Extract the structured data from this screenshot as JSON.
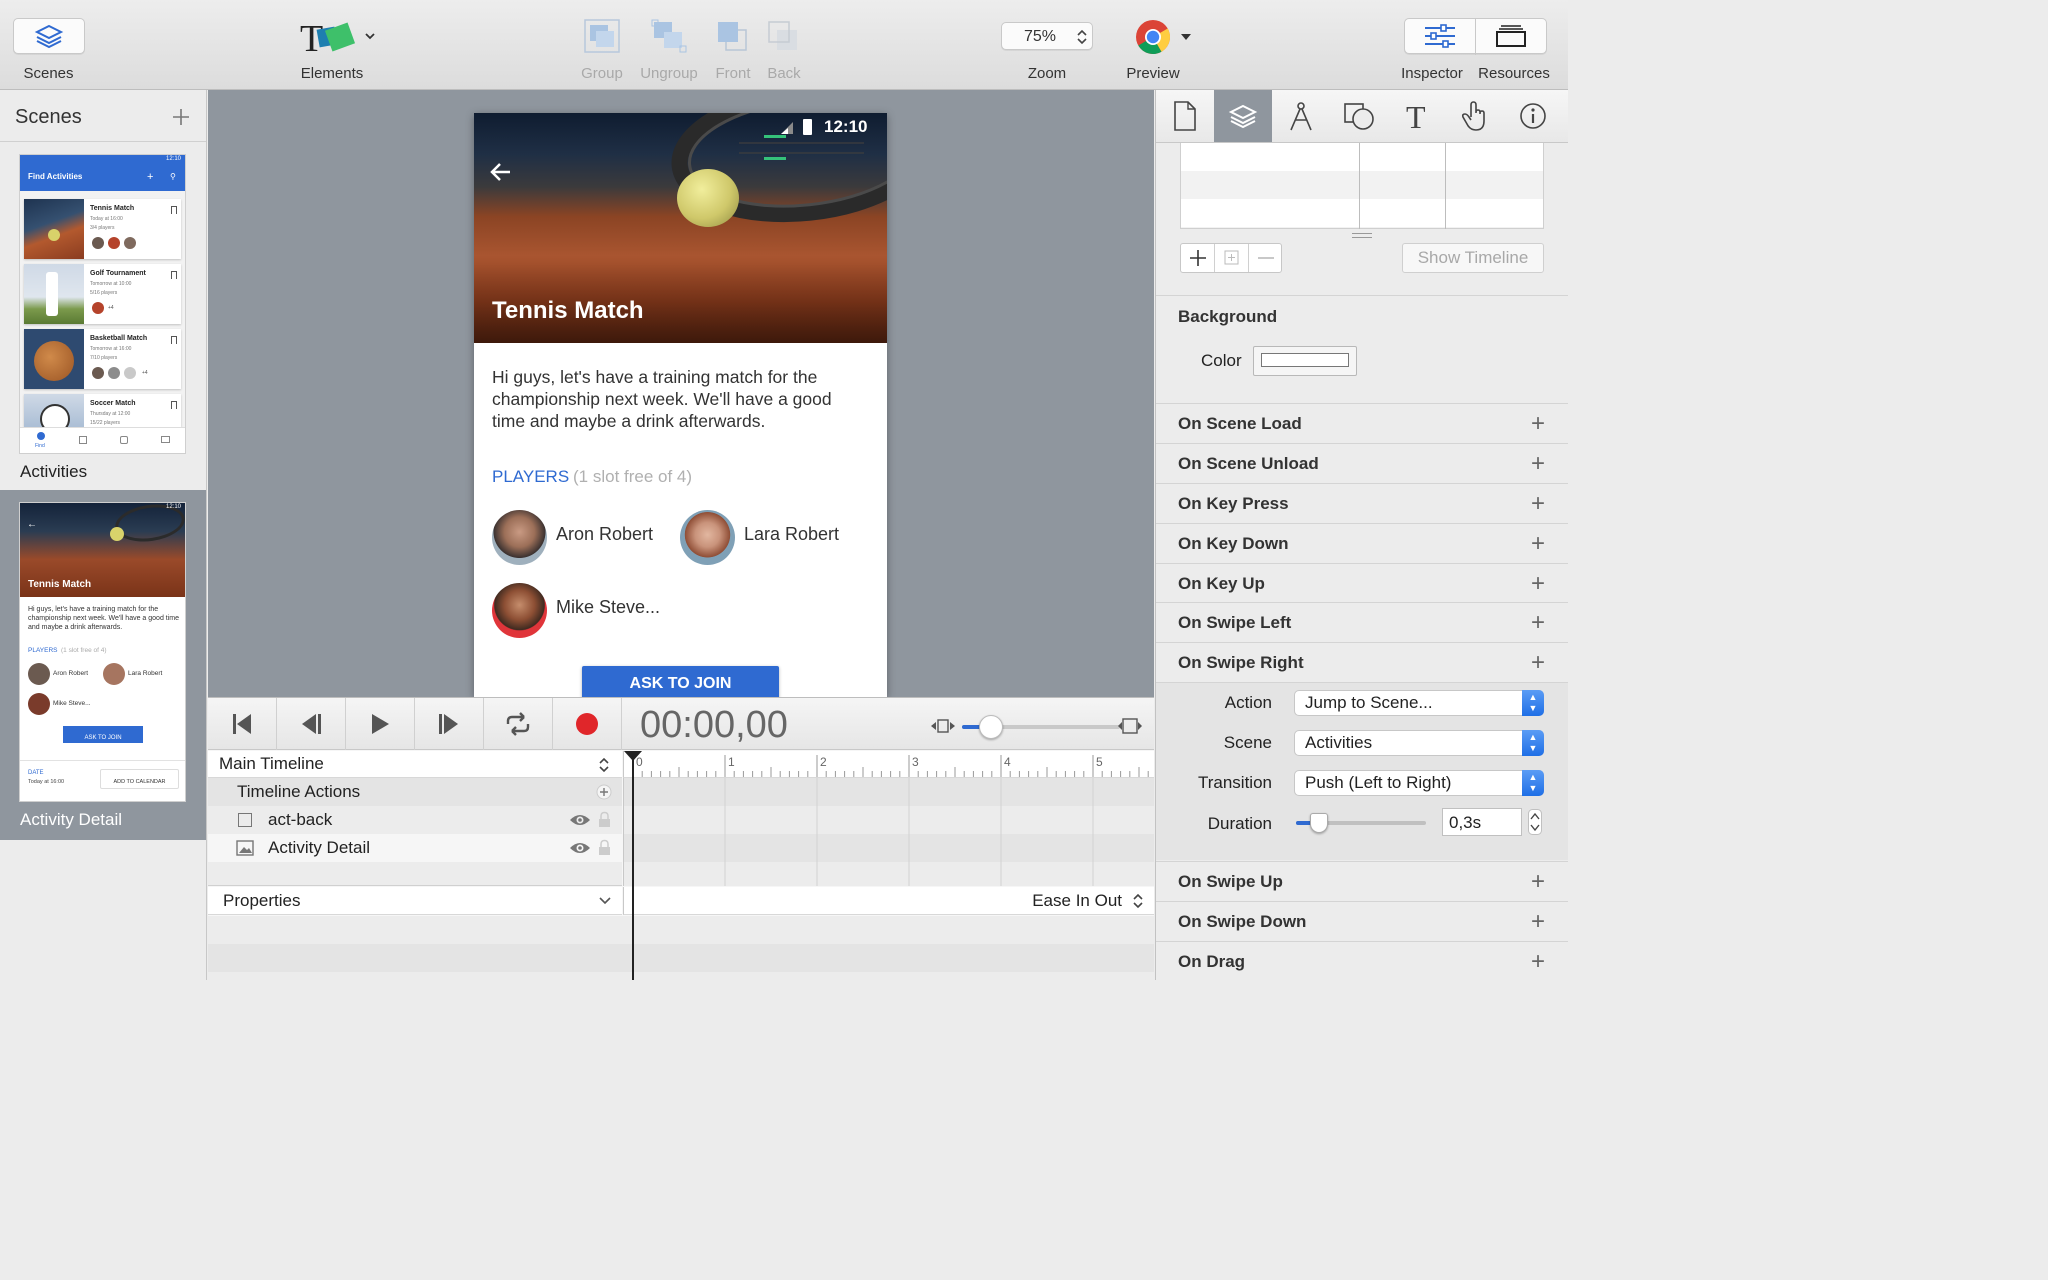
{
  "toolbar": {
    "scenes": "Scenes",
    "elements": "Elements",
    "group": "Group",
    "ungroup": "Ungroup",
    "front": "Front",
    "back": "Back",
    "zoom_value": "75%",
    "zoom": "Zoom",
    "preview": "Preview",
    "inspector": "Inspector",
    "resources": "Resources"
  },
  "scenes_panel": {
    "title": "Scenes",
    "scene1": {
      "name": "Activities",
      "time": "12:10",
      "header": "Find Activities",
      "cards": [
        {
          "title": "Tennis Match",
          "line1": "Today at 16:00",
          "line2": "3/4 players"
        },
        {
          "title": "Golf Tournament",
          "line1": "Tomorrow at 10:00",
          "line2": "5/16 players",
          "extra": "+4"
        },
        {
          "title": "Basketball Match",
          "line1": "Tomorrow at 16:00",
          "line2": "7/10 players",
          "extra": "+4"
        },
        {
          "title": "Soccer Match",
          "line1": "Thursday at 12:00",
          "line2": "15/22 players"
        }
      ],
      "nav_find": "Find"
    },
    "scene2": {
      "name": "Activity Detail",
      "time": "12:10",
      "title": "Tennis Match",
      "desc": "Hi guys, let's have a training match for the championship next week. We'll have a good time and maybe a drink afterwards.",
      "players": "PLAYERS",
      "slot": "(1 slot free of 4)",
      "p1": "Aron Robert",
      "p2": "Lara Robert",
      "p3": "Mike Steve...",
      "button": "ASK TO JOIN",
      "date_label": "DATE",
      "date_value": "Today at 16:00",
      "calendar": "ADD TO CALENDAR"
    }
  },
  "phone": {
    "time": "12:10",
    "title": "Tennis Match",
    "description": "Hi guys, let's have a training match for the championship next week. We'll have a good time and maybe a drink afterwards.",
    "players_label": "PLAYERS",
    "slot_text": "(1 slot free of 4)",
    "player1": "Aron Robert",
    "player2": "Lara Robert",
    "player3": "Mike Steve...",
    "join_button": "ASK TO JOIN"
  },
  "timeline": {
    "time": "00:00,00",
    "main": "Main Timeline",
    "actions": "Timeline Actions",
    "layer1": "act-back",
    "layer2": "Activity Detail",
    "properties": "Properties",
    "easing": "Ease In Out",
    "ticks": [
      "0",
      "1",
      "2",
      "3",
      "4",
      "5"
    ]
  },
  "inspector": {
    "show_timeline": "Show Timeline",
    "background": "Background",
    "color": "Color",
    "events": {
      "scene_load": "On Scene Load",
      "scene_unload": "On Scene Unload",
      "key_press": "On Key Press",
      "key_down": "On Key Down",
      "key_up": "On Key Up",
      "swipe_left": "On Swipe Left",
      "swipe_right": "On Swipe Right",
      "swipe_up": "On Swipe Up",
      "swipe_down": "On Swipe Down",
      "drag": "On Drag"
    },
    "action_label": "Action",
    "action_value": "Jump to Scene...",
    "scene_label": "Scene",
    "scene_value": "Activities",
    "transition_label": "Transition",
    "transition_value": "Push (Left to Right)",
    "duration_label": "Duration",
    "duration_value": "0,3s",
    "duration_level": 0.18
  },
  "colors": {
    "accent_blue": "#2f6ad1",
    "record_red": "#e0262a",
    "canvas_gray": "#8f969e"
  }
}
